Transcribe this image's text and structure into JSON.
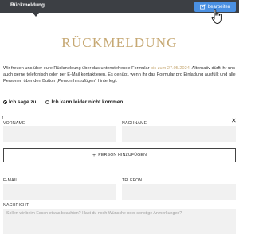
{
  "topbar": {
    "title": "Rückmeldung",
    "edit_label": "bearbeiten"
  },
  "form": {
    "title": "RÜCKMELDUNG",
    "intro_before": "Wir freuen uns über eure Rückmeldung über das untenstehende Formular ",
    "intro_date": "bis zum 27.05.2024!",
    "intro_after": " Alternativ dürft ihr uns auch gerne telefonisch oder per E-Mail kontaktieren. Es genügt, wenn ihr das Formular pro Einladung ausfüllt und alle Personen über den Button „Person hinzufügen“ hinterlegt.",
    "rsvp": {
      "yes_label": "Ich sage zu",
      "no_label": "Ich kann leider nicht kommen",
      "selected": "yes"
    },
    "person_marker": "1",
    "first_name_label": "VORNAME",
    "last_name_label": "NACHNAME",
    "remove_symbol": "✕",
    "add_person_label": "PERSON HINZUFÜGEN",
    "email_label": "E-MAIL",
    "phone_label": "TELEFON",
    "message_label": "NACHRICHT",
    "message_placeholder": "Sollen wir beim Essen etwas beachten? Hast du noch Wünsche oder sonstige Anmerkungen?"
  },
  "colors": {
    "accent_gold": "#c6a873",
    "button_blue": "#4a90e2",
    "topbar_dark": "#3c3f44",
    "input_bg": "#f1f1f1"
  },
  "icons": {
    "edit": "pencil-square-icon",
    "cursor": "hand-pointer-icon",
    "remove": "close-icon",
    "add": "plus-icon"
  }
}
